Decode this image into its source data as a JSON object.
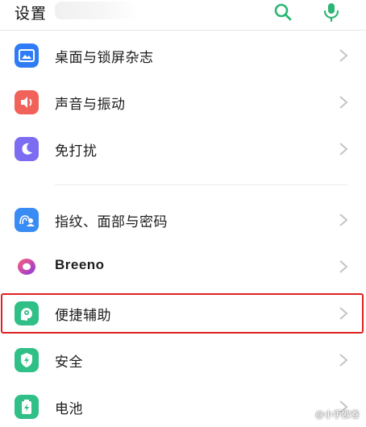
{
  "header": {
    "title": "设置",
    "search_icon": "search-icon",
    "mic_icon": "microphone-icon",
    "accent": "#2bb673"
  },
  "items": [
    {
      "label": "桌面与锁屏杂志",
      "icon": "wallpaper-icon",
      "color": "#2f7cf6"
    },
    {
      "label": "声音与振动",
      "icon": "speaker-icon",
      "color": "#f0625a"
    },
    {
      "label": "免打扰",
      "icon": "moon-icon",
      "color": "#7b6cf2"
    },
    {
      "label": "指纹、面部与密码",
      "icon": "fingerprint-face-icon",
      "color": "#3a8cf5"
    },
    {
      "label": "Breeno",
      "icon": "breeno-icon",
      "color": "#d63a8e"
    },
    {
      "label": "便捷辅助",
      "icon": "assist-icon",
      "color": "#2fbf87"
    },
    {
      "label": "安全",
      "icon": "shield-icon",
      "color": "#2fbf87"
    },
    {
      "label": "电池",
      "icon": "battery-icon",
      "color": "#2fbf87"
    }
  ],
  "highlight_color": "#e02020",
  "watermark": "@小手欧卷"
}
